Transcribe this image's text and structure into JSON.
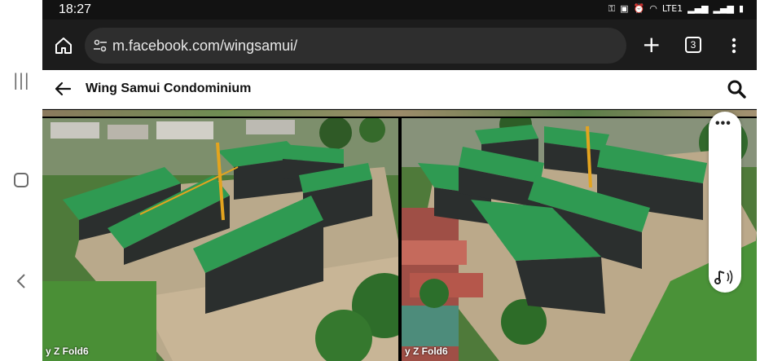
{
  "status_bar": {
    "time": "18:27",
    "network_label": "LTE1"
  },
  "browser": {
    "url": "m.facebook.com/wingsamui/",
    "tab_count": "3"
  },
  "page": {
    "title": "Wing Samui Condominium"
  },
  "photos": [
    {
      "caption": "y Z Fold6"
    },
    {
      "caption": "y Z Fold6"
    }
  ],
  "colors": {
    "browser_bar": "#1c1c1c",
    "omnibox": "#2e2e2e",
    "roof_green": "#2f9a52"
  },
  "icons": [
    "recents-icon",
    "home-nav-icon",
    "back-nav-icon",
    "home-icon",
    "tune-icon",
    "plus-icon",
    "tabs-icon",
    "menu-icon",
    "back-arrow-icon",
    "search-icon",
    "more-icon",
    "audio-icon"
  ]
}
